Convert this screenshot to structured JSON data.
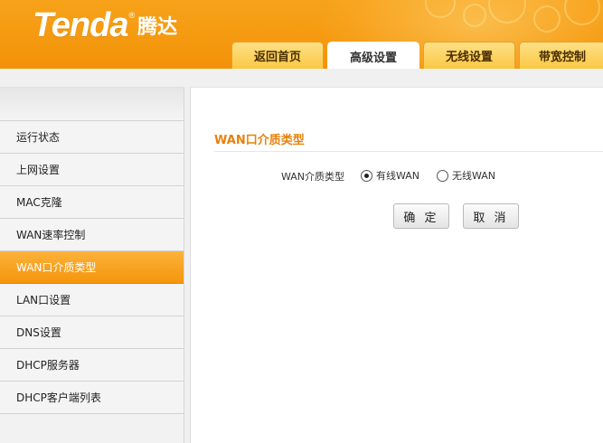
{
  "header": {
    "brand": "Tenda",
    "brand_registered": "®",
    "brand_cn": "腾达",
    "tabs": [
      {
        "label": "返回首页",
        "active": false
      },
      {
        "label": "高级设置",
        "active": true
      },
      {
        "label": "无线设置",
        "active": false
      },
      {
        "label": "带宽控制",
        "active": false
      }
    ]
  },
  "sidebar": {
    "items": [
      {
        "label": "运行状态",
        "active": false
      },
      {
        "label": "上网设置",
        "active": false
      },
      {
        "label": "MAC克隆",
        "active": false
      },
      {
        "label": "WAN速率控制",
        "active": false
      },
      {
        "label": "WAN口介质类型",
        "active": true
      },
      {
        "label": "LAN口设置",
        "active": false
      },
      {
        "label": "DNS设置",
        "active": false
      },
      {
        "label": "DHCP服务器",
        "active": false
      },
      {
        "label": "DHCP客户端列表",
        "active": false
      }
    ]
  },
  "main": {
    "section_title": "WAN口介质类型",
    "form": {
      "label": "WAN介质类型",
      "options": [
        {
          "label": "有线WAN",
          "checked": true
        },
        {
          "label": "无线WAN",
          "checked": false
        }
      ]
    },
    "buttons": {
      "ok": "确 定",
      "cancel": "取 消"
    }
  },
  "colors": {
    "header_orange": "#f59a10",
    "tab_yellow": "#fbc843",
    "active_menu": "#f5950c",
    "section_title": "#e8810a"
  }
}
